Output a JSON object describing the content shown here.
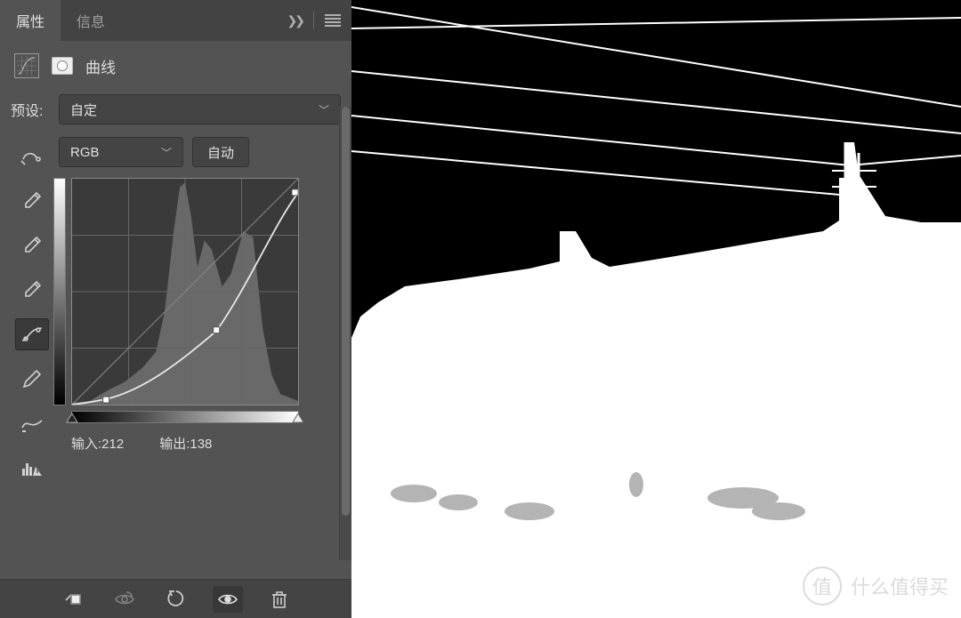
{
  "tabs": {
    "properties": "属性",
    "info": "信息"
  },
  "adjustment": {
    "title": "曲线"
  },
  "preset": {
    "label": "预设:",
    "value": "自定"
  },
  "channel": {
    "value": "RGB",
    "auto": "自动"
  },
  "io": {
    "input_label": "输入:",
    "input_value": "212",
    "output_label": "输出:",
    "output_value": "138"
  },
  "tools": {
    "finger": "target-adjust-icon",
    "eyedropper_black": "eyedropper-black-icon",
    "eyedropper_gray": "eyedropper-gray-icon",
    "eyedropper_white": "eyedropper-white-icon",
    "curve": "curve-point-icon",
    "pencil": "pencil-icon",
    "smooth": "smooth-icon",
    "histogram_warn": "histogram-warning-icon"
  },
  "bottom": {
    "clip": "clip-to-layer-icon",
    "eye_prev": "view-previous-icon",
    "reset": "reset-icon",
    "visibility": "visibility-icon",
    "trash": "trash-icon"
  },
  "chart_data": {
    "type": "line",
    "title": "Curves",
    "xlabel": "Input",
    "ylabel": "Output",
    "xlim": [
      0,
      255
    ],
    "ylim": [
      0,
      255
    ],
    "points": [
      {
        "x": 0,
        "y": 0
      },
      {
        "x": 38,
        "y": 6
      },
      {
        "x": 164,
        "y": 84
      },
      {
        "x": 255,
        "y": 240
      }
    ],
    "input": 212,
    "output": 138
  },
  "watermark": {
    "badge": "值",
    "text": "什么值得买"
  }
}
